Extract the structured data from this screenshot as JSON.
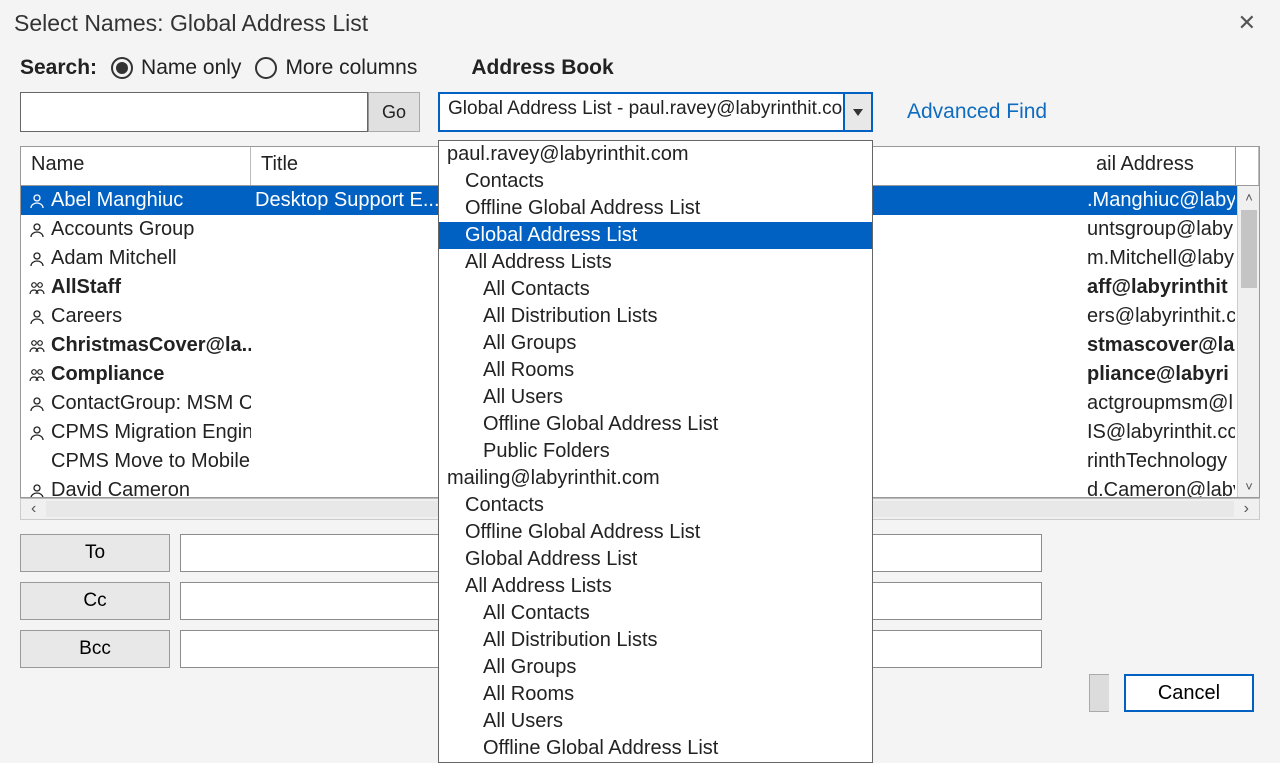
{
  "title": "Select Names: Global Address List",
  "search_label": "Search:",
  "radio_name_only": "Name only",
  "radio_more_cols": "More columns",
  "address_book_label": "Address Book",
  "go_label": "Go",
  "combo_value": "Global Address List - paul.ravey@labyrinthit.com",
  "advanced_find": "Advanced Find",
  "columns": {
    "name": "Name",
    "title": "Title",
    "email": "ail Address"
  },
  "rows": [
    {
      "icon": "person",
      "name": "Abel Manghiuc",
      "title": "Desktop Support E...",
      "email": ".Manghiuc@laby",
      "bold": false,
      "selected": true
    },
    {
      "icon": "person",
      "name": "Accounts Group",
      "title": "",
      "email": "untsgroup@laby",
      "bold": false,
      "selected": false
    },
    {
      "icon": "person",
      "name": "Adam Mitchell",
      "title": "",
      "email": "m.Mitchell@labyr",
      "bold": false,
      "selected": false
    },
    {
      "icon": "group",
      "name": "AllStaff",
      "title": "",
      "email": "aff@labyrinthit",
      "bold": true,
      "selected": false
    },
    {
      "icon": "person",
      "name": "Careers",
      "title": "",
      "email": "ers@labyrinthit.c",
      "bold": false,
      "selected": false
    },
    {
      "icon": "group",
      "name": "ChristmasCover@la...",
      "title": "",
      "email": "stmascover@la",
      "bold": true,
      "selected": false
    },
    {
      "icon": "group",
      "name": "Compliance",
      "title": "",
      "email": "pliance@labyri",
      "bold": true,
      "selected": false
    },
    {
      "icon": "person",
      "name": "ContactGroup: MSM C...",
      "title": "",
      "email": "actgroupmsm@l",
      "bold": false,
      "selected": false
    },
    {
      "icon": "person",
      "name": "CPMS Migration Engin...",
      "title": "",
      "email": "IS@labyrinthit.cc",
      "bold": false,
      "selected": false
    },
    {
      "icon": "none",
      "name": "CPMS Move to Mobile",
      "title": "",
      "email": "rinthTechnology",
      "bold": false,
      "selected": false
    },
    {
      "icon": "person-o",
      "name": "David Cameron",
      "title": "",
      "email": "d.Cameron@laby",
      "bold": false,
      "selected": false
    }
  ],
  "recipients": {
    "to": "To",
    "cc": "Cc",
    "bcc": "Bcc"
  },
  "buttons": {
    "cancel": "Cancel"
  },
  "dropdown": [
    {
      "t": "paul.ravey@labyrinthit.com",
      "i": 0
    },
    {
      "t": "Contacts",
      "i": 1
    },
    {
      "t": "Offline Global Address List",
      "i": 1
    },
    {
      "t": "Global Address List",
      "i": 1,
      "sel": true
    },
    {
      "t": "All Address Lists",
      "i": 1
    },
    {
      "t": "All Contacts",
      "i": 2
    },
    {
      "t": "All Distribution Lists",
      "i": 2
    },
    {
      "t": "All Groups",
      "i": 2
    },
    {
      "t": "All Rooms",
      "i": 2
    },
    {
      "t": "All Users",
      "i": 2
    },
    {
      "t": "Offline Global Address List",
      "i": 2
    },
    {
      "t": "Public Folders",
      "i": 2
    },
    {
      "t": "mailing@labyrinthit.com",
      "i": 0
    },
    {
      "t": "Contacts",
      "i": 1
    },
    {
      "t": "Offline Global Address List",
      "i": 1
    },
    {
      "t": "Global Address List",
      "i": 1
    },
    {
      "t": "All Address Lists",
      "i": 1
    },
    {
      "t": "All Contacts",
      "i": 2
    },
    {
      "t": "All Distribution Lists",
      "i": 2
    },
    {
      "t": "All Groups",
      "i": 2
    },
    {
      "t": "All Rooms",
      "i": 2
    },
    {
      "t": "All Users",
      "i": 2
    },
    {
      "t": "Offline Global Address List",
      "i": 2
    }
  ]
}
